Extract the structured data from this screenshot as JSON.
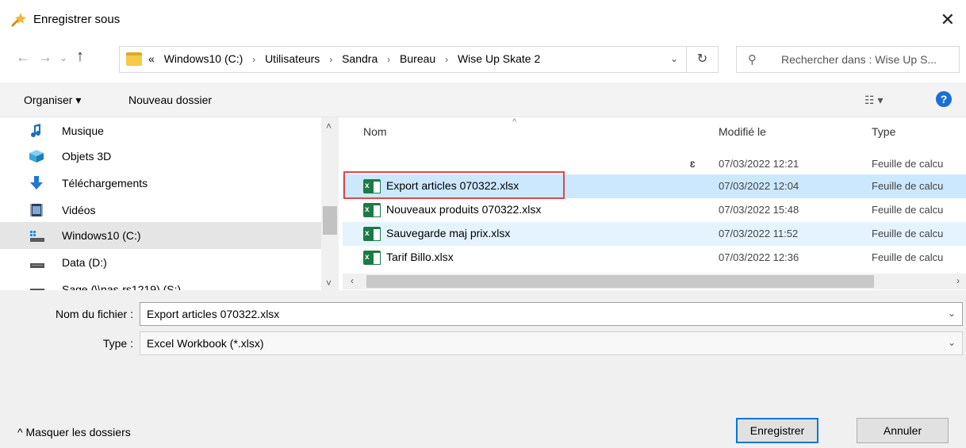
{
  "window": {
    "title": "Enregistrer sous",
    "close_glyph": "✕"
  },
  "nav": {
    "back": "←",
    "forward": "→",
    "recent": "⌄",
    "up": "↑"
  },
  "address": {
    "overflow": "«",
    "crumbs": [
      "Windows10 (C:)",
      "Utilisateurs",
      "Sandra",
      "Bureau",
      "Wise Up Skate 2"
    ],
    "separator": "›",
    "dropdown": "⌄",
    "refresh": "↻"
  },
  "search": {
    "placeholder": "Rechercher dans : Wise Up S...",
    "icon": "⚲"
  },
  "toolbar": {
    "organize_label": "Organiser ▾",
    "new_folder_label": "Nouveau dossier",
    "view_label": "☷ ▾",
    "help_label": "?"
  },
  "sidebar": {
    "items": [
      {
        "label": "Musique",
        "icon": "music-icon"
      },
      {
        "label": "Objets 3D",
        "icon": "objects3d-icon"
      },
      {
        "label": "Téléchargements",
        "icon": "download-icon"
      },
      {
        "label": "Vidéos",
        "icon": "video-icon"
      },
      {
        "label": "Windows10 (C:)",
        "icon": "drive-icon",
        "selected": true
      },
      {
        "label": "Data (D:)",
        "icon": "drive-icon"
      },
      {
        "label": "Sage (\\\\nas-rs1219) (S:)",
        "icon": "network-drive-icon"
      }
    ],
    "scroll_up": "˄",
    "scroll_down": "˅"
  },
  "file_list": {
    "columns": [
      "Nom",
      "Modifié le",
      "Type"
    ],
    "sort_glyph": "^",
    "partial_row": {
      "name_fragment": "ɛ",
      "modified": "07/03/2022 12:21",
      "type": "Feuille de calcu"
    },
    "rows": [
      {
        "name": "Export articles 070322.xlsx",
        "modified": "07/03/2022 12:04",
        "type": "Feuille de calcu",
        "state": "selected"
      },
      {
        "name": "Nouveaux produits 070322.xlsx",
        "modified": "07/03/2022 15:48",
        "type": "Feuille de calcu",
        "state": "normal"
      },
      {
        "name": "Sauvegarde maj prix.xlsx",
        "modified": "07/03/2022 11:52",
        "type": "Feuille de calcu",
        "state": "hover"
      },
      {
        "name": "Tarif Billo.xlsx",
        "modified": "07/03/2022 12:36",
        "type": "Feuille de calcu",
        "state": "normal"
      }
    ],
    "xls_icon_letter": "x",
    "scroll_left": "‹",
    "scroll_right": "›"
  },
  "form": {
    "filename_label": "Nom du fichier :",
    "filename_value": "Export articles 070322.xlsx",
    "type_label": "Type :",
    "type_value": "Excel Workbook (*.xlsx)",
    "dropdown_glyph": "⌄"
  },
  "footer": {
    "hide_folders_label": "^  Masquer les dossiers",
    "save_label": "Enregistrer",
    "cancel_label": "Annuler"
  },
  "colors": {
    "selected_row": "#cce8ff",
    "hover_row": "#e5f3ff",
    "highlight_outline": "#e04848",
    "accent": "#0078d7",
    "excel_green": "#1d7a45"
  }
}
